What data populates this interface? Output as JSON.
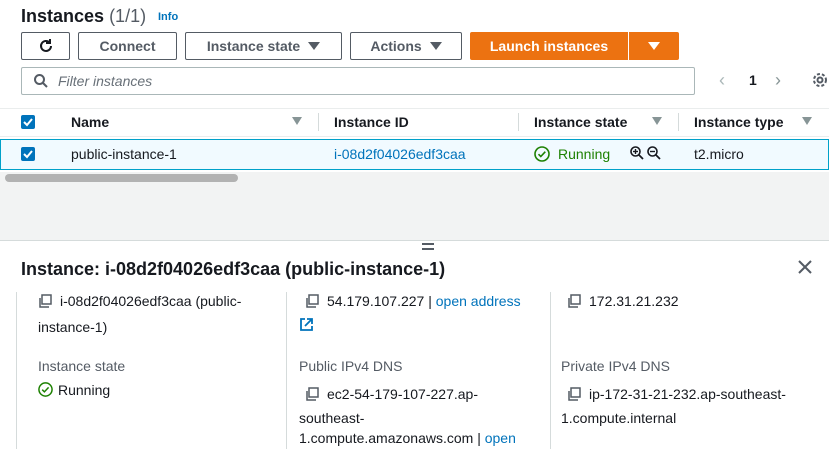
{
  "header": {
    "title": "Instances",
    "count": "(1/1)",
    "info": "Info"
  },
  "toolbar": {
    "refresh_icon": "refresh-icon",
    "connect": "Connect",
    "instance_state": "Instance state",
    "actions": "Actions",
    "launch": "Launch instances"
  },
  "filter": {
    "placeholder": "Filter instances",
    "value": ""
  },
  "pagination": {
    "page": "1"
  },
  "table": {
    "columns": [
      "Name",
      "Instance ID",
      "Instance state",
      "Instance type"
    ],
    "rows": [
      {
        "name": "public-instance-1",
        "instance_id": "i-08d2f04026edf3caa",
        "state": "Running",
        "type": "t2.micro",
        "selected": true
      }
    ]
  },
  "details": {
    "title": "Instance: i-08d2f04026edf3caa (public-instance-1)",
    "instance_id_line1": "i-08d2f04026edf3caa (public-",
    "instance_id_line2": "instance-1)",
    "public_ip": "54.179.107.227",
    "separator": "|",
    "open_address": "open address",
    "private_ip": "172.31.21.232",
    "instance_state_label": "Instance state",
    "instance_state_value": "Running",
    "public_dns_label": "Public IPv4 DNS",
    "public_dns_line1": "ec2-54-179-107-227.ap-",
    "public_dns_line2": "southeast-",
    "public_dns_line3": "1.compute.amazonaws.com",
    "public_dns_open": "open",
    "private_dns_label": "Private IPv4 DNS",
    "private_dns_line1": "ip-172-31-21-232.ap-southeast-",
    "private_dns_line2": "1.compute.internal"
  },
  "colors": {
    "accent": "#ec7211",
    "link": "#0073bb",
    "running": "#1d8102",
    "selected_row_bg": "#f1faff",
    "selected_row_border": "#00a1c9"
  }
}
